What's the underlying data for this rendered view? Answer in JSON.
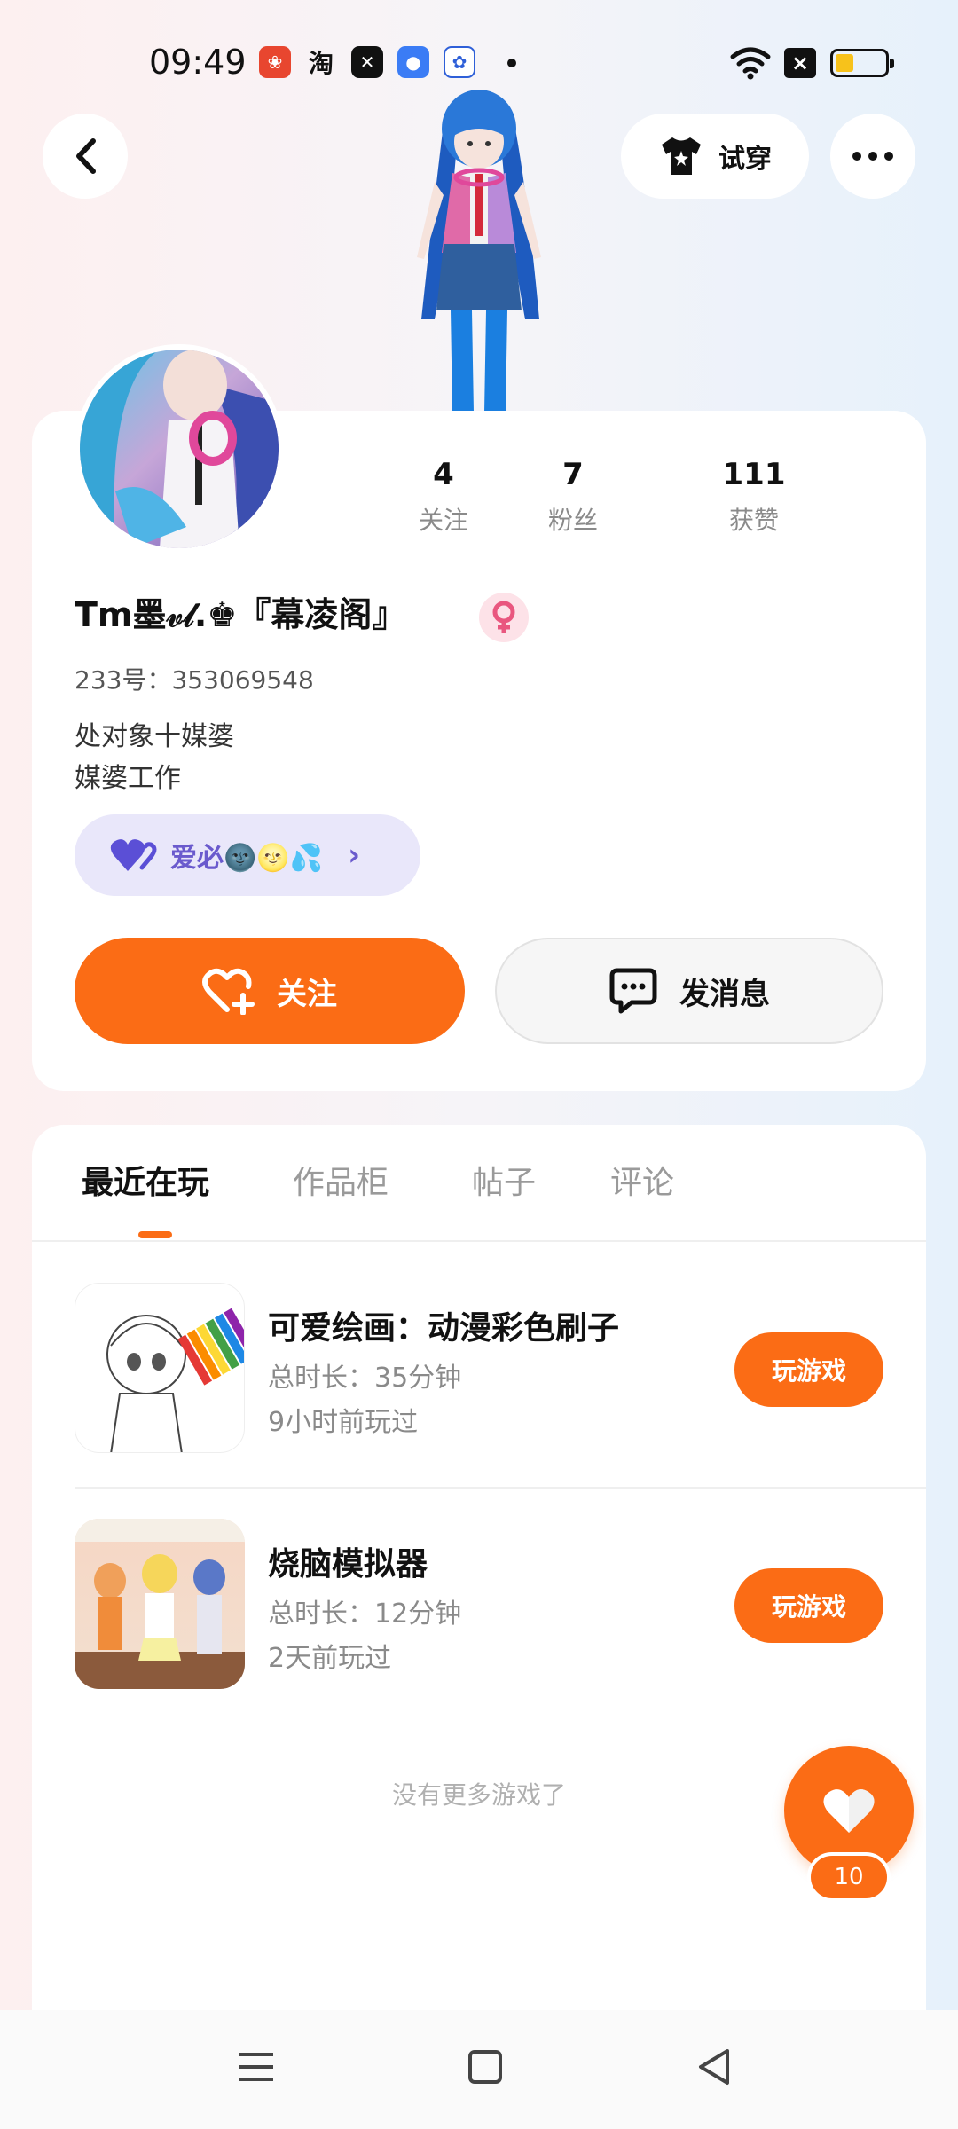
{
  "status_bar": {
    "time": "09:49",
    "notif_icons": [
      "pinduoduo-icon",
      "taobao-icon",
      "capcut-icon",
      "chat-app-icon",
      "baidu-icon"
    ],
    "notif_labels": [
      "",
      "淘",
      "",
      "",
      ""
    ]
  },
  "header": {
    "tryon_label": "试穿"
  },
  "profile": {
    "username": "Tm墨𝓋𝓁.♚『幕凌阁』",
    "id_line": "233号：353069548",
    "bio": [
      "处对象十媒婆",
      "媒婆工作"
    ],
    "tag_text": "爱必🌚🌝💦",
    "stats": [
      {
        "num": "4",
        "label": "关注"
      },
      {
        "num": "7",
        "label": "粉丝"
      },
      {
        "num": "111",
        "label": "获赞"
      }
    ],
    "follow_label": "关注",
    "message_label": "发消息"
  },
  "tabs": [
    {
      "label": "最近在玩",
      "active": true
    },
    {
      "label": "作品柜",
      "active": false
    },
    {
      "label": "帖子",
      "active": false
    },
    {
      "label": "评论",
      "active": false
    }
  ],
  "games": [
    {
      "title": "可爱绘画：动漫彩色刷子",
      "duration": "总时长：35分钟",
      "last_played": "9小时前玩过",
      "button": "玩游戏"
    },
    {
      "title": "烧脑模拟器",
      "duration": "总时长：12分钟",
      "last_played": "2天前玩过",
      "button": "玩游戏"
    }
  ],
  "end_text": "没有更多游戏了",
  "fab": {
    "badge": "10"
  },
  "colors": {
    "accent": "#fb6c15",
    "tag_bg": "#e9e7fa",
    "tag_text": "#6a5acd"
  }
}
